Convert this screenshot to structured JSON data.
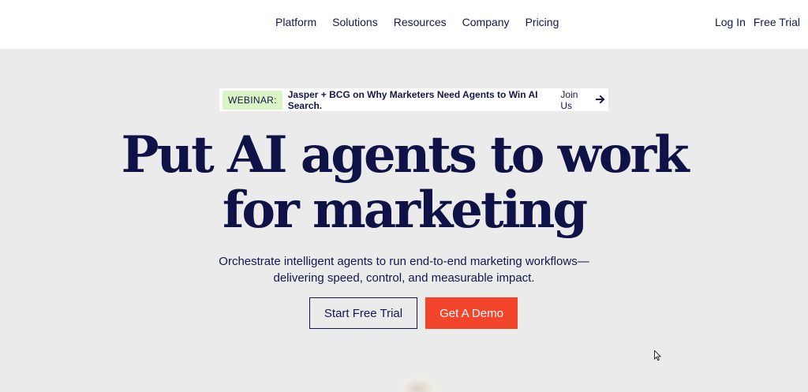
{
  "nav": {
    "items": [
      {
        "label": "Platform"
      },
      {
        "label": "Solutions"
      },
      {
        "label": "Resources"
      },
      {
        "label": "Company"
      },
      {
        "label": "Pricing"
      }
    ],
    "login_label": "Log In",
    "trial_label": "Free Trial"
  },
  "banner": {
    "tag": "WEBINAR:",
    "message": "Jasper + BCG on Why Marketers Need Agents to Win AI Search.",
    "link": "Join Us",
    "icon": "arrow-right-icon"
  },
  "hero": {
    "headline_line1": "Put AI agents to work",
    "headline_line2": "for marketing",
    "subtitle_line1": "Orchestrate intelligent agents to run end-to-end marketing workflows—",
    "subtitle_line2": "delivering speed, control, and measurable impact.",
    "primary_cta": "Start Free Trial",
    "secondary_cta": "Get A Demo"
  },
  "colors": {
    "navy": "#13174a",
    "cta_red": "#f2452c",
    "tag_green": "#d9f5c5",
    "hero_bg": "#ebebeb"
  }
}
